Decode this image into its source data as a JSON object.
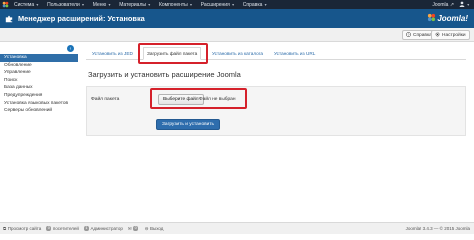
{
  "topnav": {
    "items": [
      {
        "label": "Система"
      },
      {
        "label": "Пользователи"
      },
      {
        "label": "Меню"
      },
      {
        "label": "Материалы"
      },
      {
        "label": "Компоненты"
      },
      {
        "label": "Расширения"
      },
      {
        "label": "Справка"
      }
    ],
    "site_link": "Joomla ↗"
  },
  "header": {
    "title": "Менеджер расширений: Установка",
    "brand": "Joomla!"
  },
  "toolbar": {
    "options_label": "Настройки",
    "help_label": "Справка"
  },
  "sidebar": {
    "items": [
      {
        "label": "Установка",
        "active": true
      },
      {
        "label": "Обновление"
      },
      {
        "label": "Управление"
      },
      {
        "label": "Поиск"
      },
      {
        "label": "База данных"
      },
      {
        "label": "Предупреждения"
      },
      {
        "label": "Установка языковых пакетов"
      },
      {
        "label": "Серверы обновлений"
      }
    ]
  },
  "tabs": [
    {
      "label": "Установить из JED"
    },
    {
      "label": "Загрузить файл пакета",
      "active": true
    },
    {
      "label": "Установить из каталога"
    },
    {
      "label": "Установить из URL"
    }
  ],
  "main": {
    "section_title": "Загрузить и установить расширение Joomla",
    "package_file_label": "Файл пакета",
    "choose_file_label": "Выберите файл",
    "file_status": "Файл не выбран",
    "upload_button_label": "Загрузить и установить"
  },
  "footer": {
    "view_site": "Просмотр сайта",
    "visitors_count": "0",
    "visitors_label": "посетителей",
    "admins_count": "1",
    "admins_label": "Администратор",
    "messages_count": "0",
    "logout": "Выход",
    "copyright": "Joomla! 3.4.3 — © 2015 Joomla"
  },
  "colors": {
    "topnav_bg": "#1a2637",
    "header_bg": "#17568c",
    "accent": "#2e6dad",
    "highlight": "#d5212b"
  }
}
